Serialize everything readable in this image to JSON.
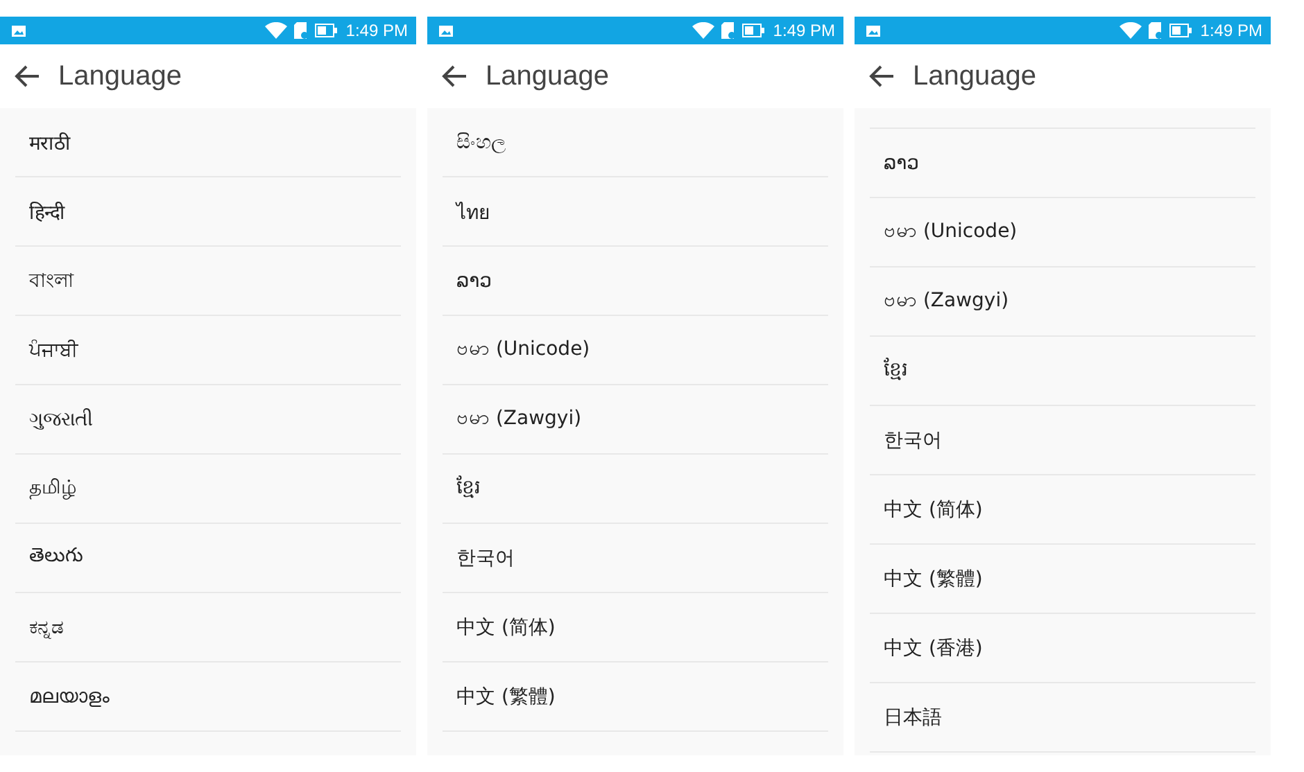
{
  "screens": [
    {
      "status_bar": {
        "time": "1:49 PM"
      },
      "title": "Language",
      "clipped_top": false,
      "languages": [
        "मराठी",
        "हिन्दी",
        "বাংলা",
        "ਪੰਜਾਬੀ",
        "ગુજરાતી",
        "தமிழ்",
        "తెలుగు",
        "ಕನ್ನಡ",
        "മലയാളം"
      ]
    },
    {
      "status_bar": {
        "time": "1:49 PM"
      },
      "title": "Language",
      "clipped_top": false,
      "languages": [
        "සිංහල",
        "ไทย",
        "ລາວ",
        "ဗမာ (Unicode)",
        "ဗမာ (Zawgyi)",
        "ខ្មែរ",
        "한국어",
        "中文 (简体)",
        "中文 (繁體)"
      ]
    },
    {
      "status_bar": {
        "time": "1:49 PM"
      },
      "title": "Language",
      "clipped_top": true,
      "languages": [
        "ລາວ",
        "ဗမာ (Unicode)",
        "ဗမာ (Zawgyi)",
        "ខ្មែរ",
        "한국어",
        "中文 (简体)",
        "中文 (繁體)",
        "中文 (香港)",
        "日本語"
      ]
    }
  ]
}
